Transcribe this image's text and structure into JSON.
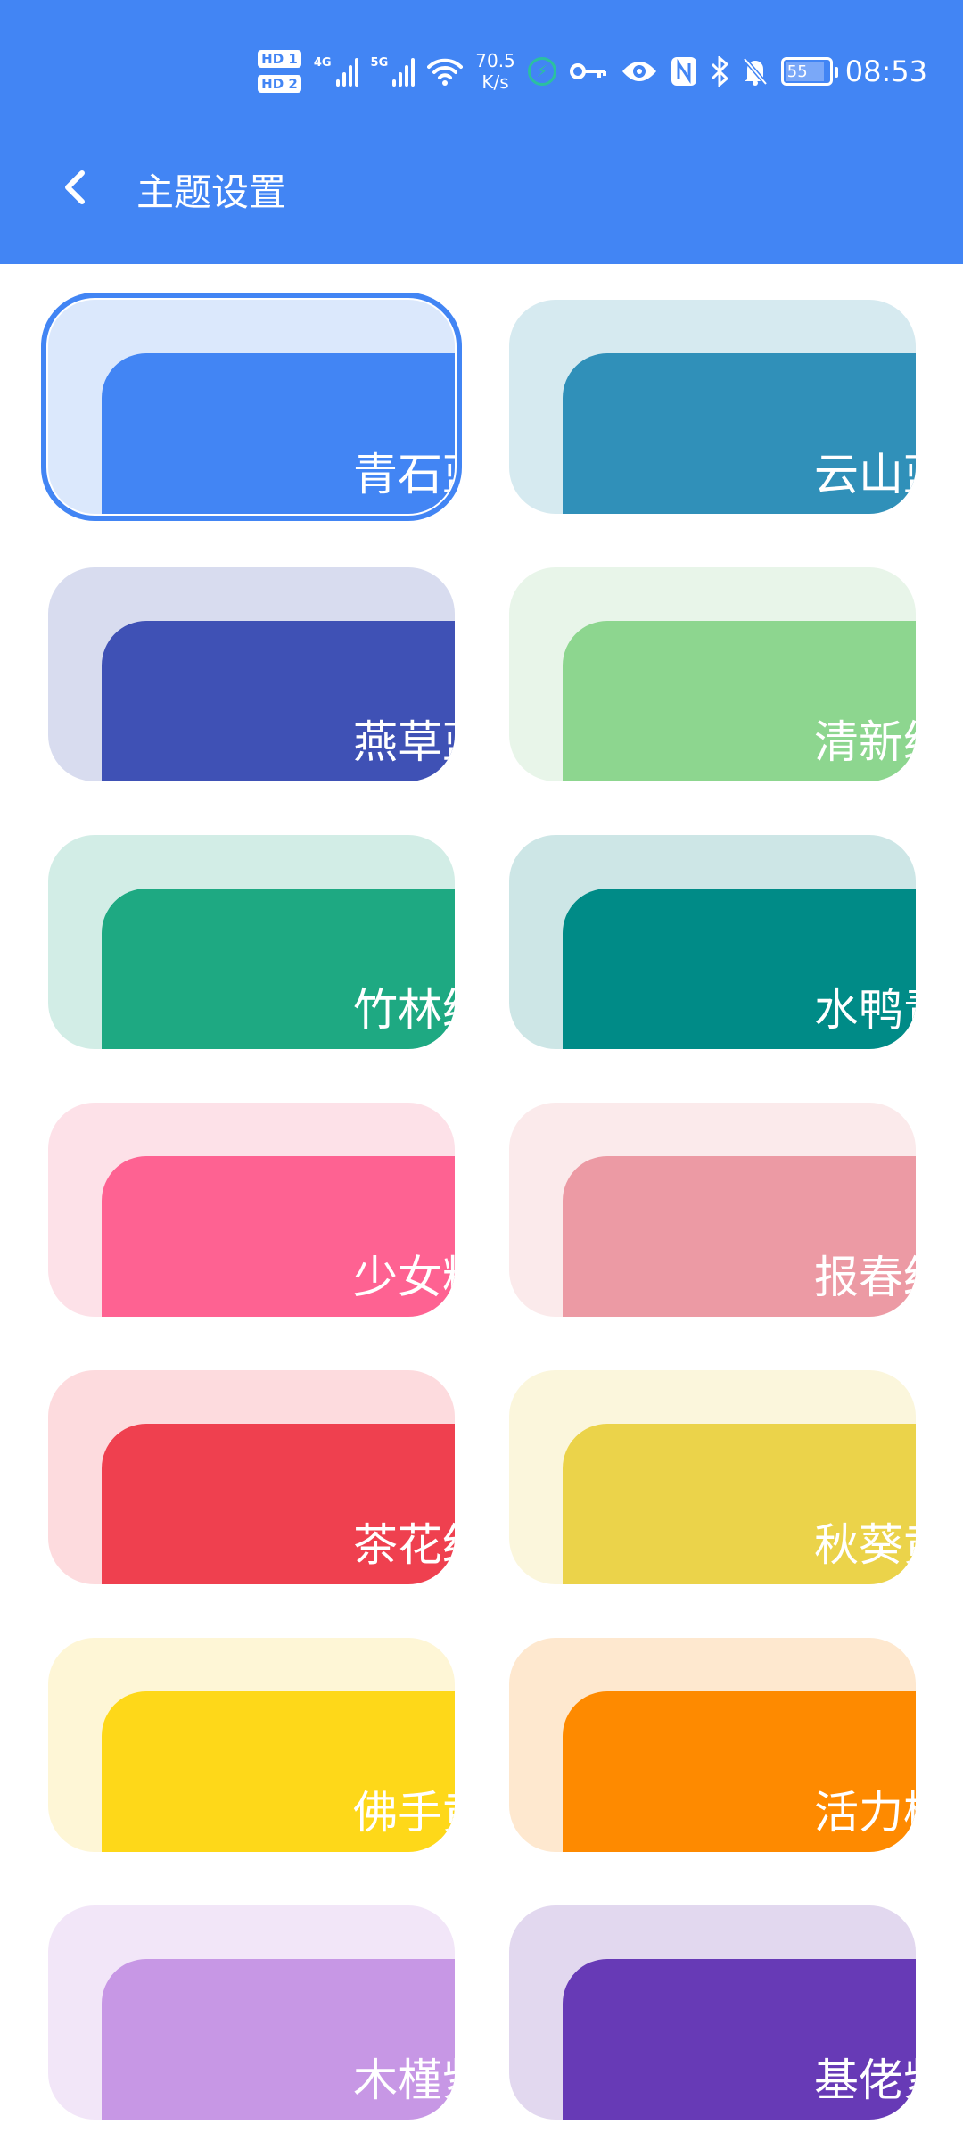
{
  "status_bar": {
    "sim1": "HD 1",
    "sim2": "HD 2",
    "net1": "4G",
    "net2": "5G",
    "speed_value": "70.5",
    "speed_unit": "K/s",
    "battery": "55",
    "time": "08:53",
    "icons": [
      "hd-icon",
      "signal-4g-icon",
      "signal-5g-icon",
      "wifi-icon",
      "charging-icon",
      "key-icon",
      "eye-icon",
      "nfc-icon",
      "bluetooth-icon",
      "bell-off-icon",
      "battery-icon"
    ]
  },
  "header": {
    "title": "主题设置",
    "back_icon": "chevron-left-icon"
  },
  "themes": [
    {
      "name": "青石蓝",
      "light": "#dbe8fc",
      "color": "#4285f4",
      "selected": true
    },
    {
      "name": "云山蓝",
      "light": "#d6eaf0",
      "color": "#3090b9",
      "selected": false
    },
    {
      "name": "燕草蓝",
      "light": "#d8dcef",
      "color": "#3f51b5",
      "selected": false
    },
    {
      "name": "清新绿",
      "light": "#e8f5e9",
      "color": "#8dd68f",
      "selected": false
    },
    {
      "name": "竹林绿",
      "light": "#d2ede6",
      "color": "#1ea982",
      "selected": false
    },
    {
      "name": "水鸭青",
      "light": "#cde6e6",
      "color": "#008b87",
      "selected": false
    },
    {
      "name": "少女粉",
      "light": "#fde1e8",
      "color": "#fe6292",
      "selected": false
    },
    {
      "name": "报春红",
      "light": "#fbeaeb",
      "color": "#ec9aa4",
      "selected": false
    },
    {
      "name": "茶花红",
      "light": "#fddbde",
      "color": "#ef404f",
      "selected": false
    },
    {
      "name": "秋葵黄",
      "light": "#fbf6dc",
      "color": "#ebd34a",
      "selected": false
    },
    {
      "name": "佛手黄",
      "light": "#fef6d6",
      "color": "#fed819",
      "selected": false
    },
    {
      "name": "活力橙",
      "light": "#fee8cf",
      "color": "#fe8a00",
      "selected": false
    },
    {
      "name": "木槿紫",
      "light": "#f2e6f8",
      "color": "#c797e5",
      "selected": false
    },
    {
      "name": "基佬紫",
      "light": "#e2d8ef",
      "color": "#673ab6",
      "selected": false
    }
  ]
}
